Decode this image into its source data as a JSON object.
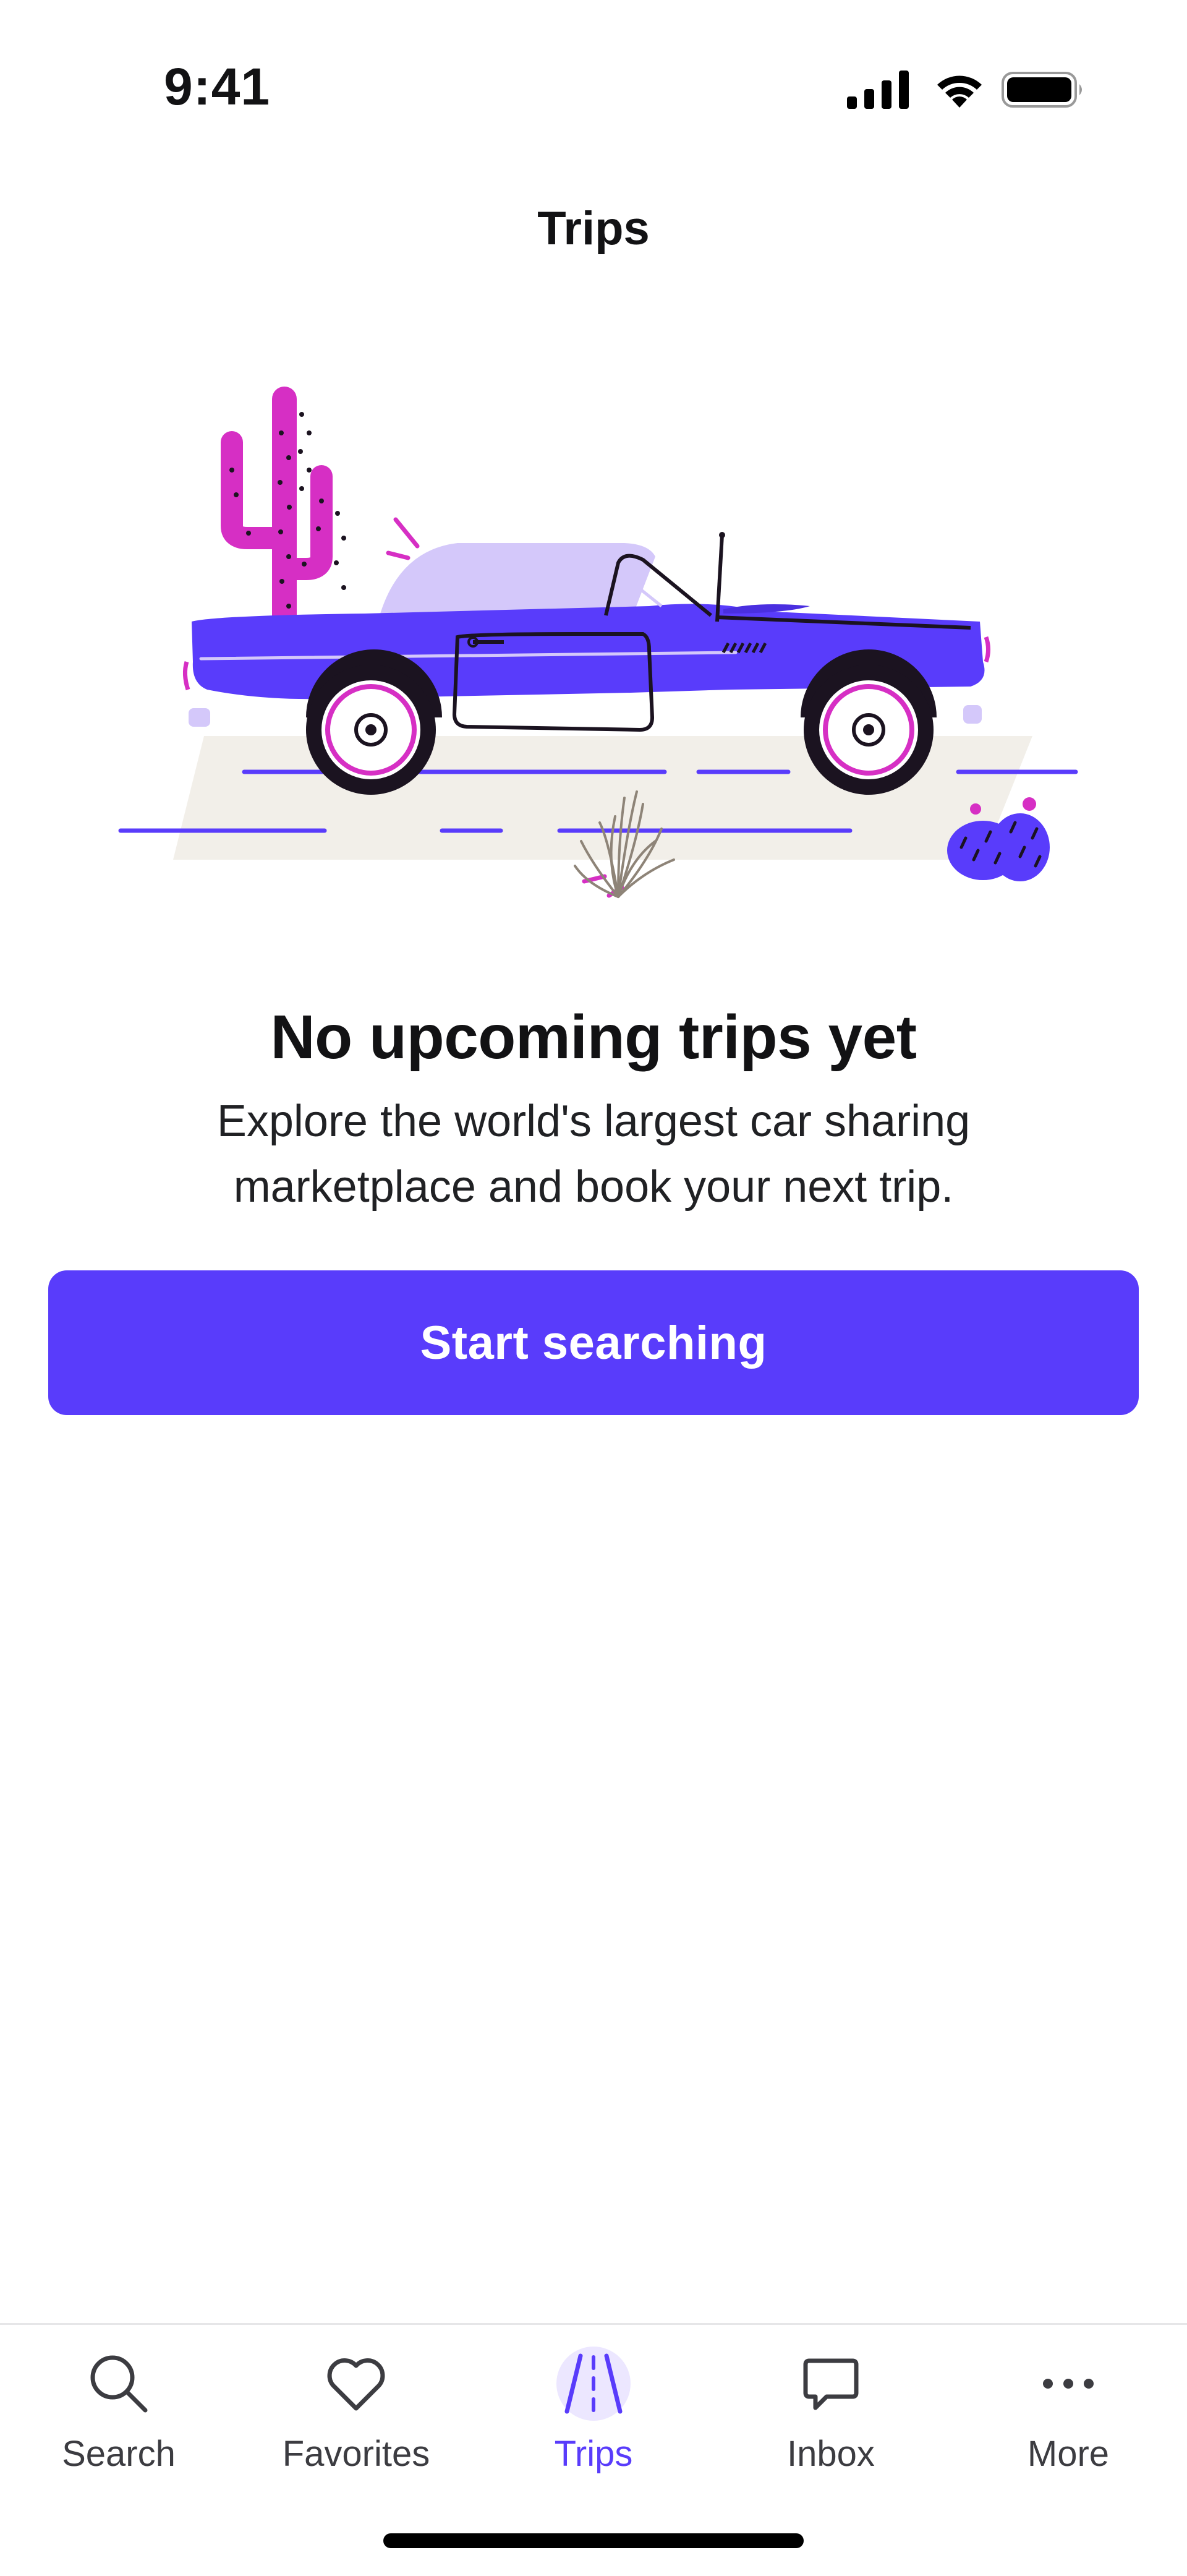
{
  "status_bar": {
    "time": "9:41",
    "icons": [
      "cellular-signal-icon",
      "wifi-icon",
      "battery-icon"
    ]
  },
  "header": {
    "title": "Trips"
  },
  "empty_state": {
    "illustration": "convertible-car-desert-illustration",
    "title": "No upcoming trips yet",
    "body": "Explore the world's largest car sharing marketplace and book your next trip.",
    "cta_label": "Start searching"
  },
  "tab_bar": {
    "active": "Trips",
    "tabs": [
      {
        "label": "Search",
        "icon": "search-icon"
      },
      {
        "label": "Favorites",
        "icon": "heart-icon"
      },
      {
        "label": "Trips",
        "icon": "road-icon"
      },
      {
        "label": "Inbox",
        "icon": "chat-bubble-icon"
      },
      {
        "label": "More",
        "icon": "more-dots-icon"
      }
    ]
  },
  "colors": {
    "brand": "#593cfb",
    "car_body": "#593cfb",
    "car_roof": "#d4c8fa",
    "cactus": "#d62fc4",
    "ground": "#f2efe9",
    "text": "#121214"
  }
}
